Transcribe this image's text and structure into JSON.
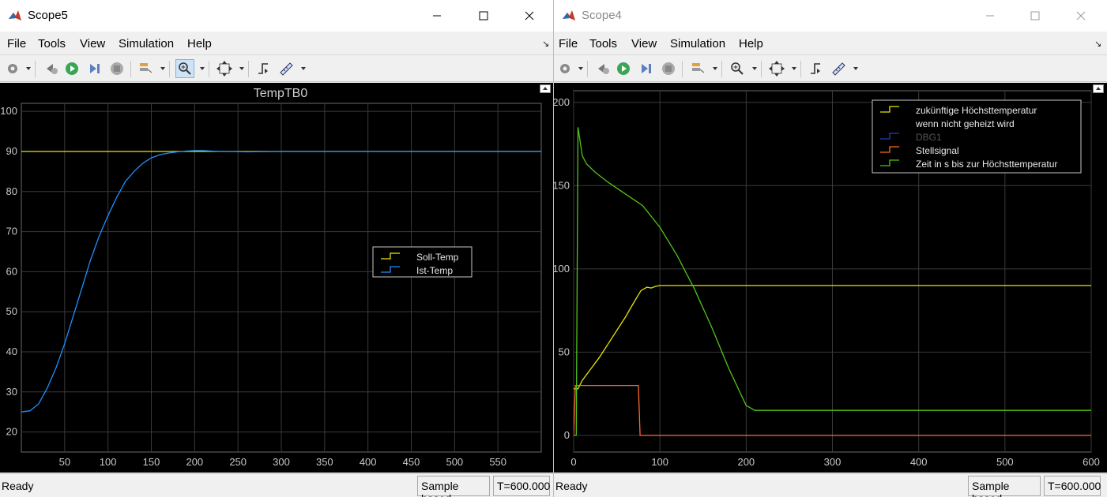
{
  "menu": [
    "File",
    "Tools",
    "View",
    "Simulation",
    "Help"
  ],
  "scope5": {
    "title": "Scope5",
    "status": "Ready",
    "sample_mode": "Sample based",
    "time": "T=600.000",
    "chart_data": {
      "type": "line",
      "title": "TempTB0",
      "xlim": [
        0,
        600
      ],
      "ylim": [
        15,
        102
      ],
      "xticks": [
        50,
        100,
        150,
        200,
        250,
        300,
        350,
        400,
        450,
        500,
        550
      ],
      "yticks": [
        20,
        30,
        40,
        50,
        60,
        70,
        80,
        90,
        100
      ],
      "grid": true,
      "legend_position": "center-right",
      "series": [
        {
          "name": "Soll-Temp",
          "color": "#e6e600",
          "x": [
            0,
            600
          ],
          "y": [
            90,
            90
          ]
        },
        {
          "name": "Ist-Temp",
          "color": "#1e90ff",
          "x": [
            0,
            10,
            20,
            30,
            40,
            50,
            60,
            70,
            80,
            90,
            100,
            110,
            120,
            130,
            140,
            150,
            160,
            170,
            180,
            190,
            200,
            210,
            220,
            230,
            240,
            260,
            300,
            400,
            500,
            600
          ],
          "y": [
            25,
            25.3,
            27,
            31,
            36,
            42,
            49,
            56,
            63,
            69,
            74,
            78.5,
            82.5,
            85,
            87,
            88.4,
            89.2,
            89.6,
            89.9,
            90.1,
            90.2,
            90.2,
            90.1,
            90,
            90,
            89.9,
            90,
            90,
            90,
            90
          ]
        }
      ]
    }
  },
  "scope4": {
    "title": "Scope4",
    "status": "Ready",
    "sample_mode": "Sample based",
    "time": "T=600.000",
    "chart_data": {
      "type": "line",
      "title": "",
      "xlim": [
        0,
        600
      ],
      "ylim": [
        -10,
        207
      ],
      "xticks": [
        0,
        100,
        200,
        300,
        400,
        500,
        600
      ],
      "yticks": [
        0,
        50,
        100,
        150,
        200
      ],
      "grid": true,
      "legend_position": "top-right",
      "series": [
        {
          "name": "zukünftige Höchsttemperatur wenn nicht geheizt wird",
          "color": "#e6e600",
          "x": [
            0,
            5,
            10,
            20,
            30,
            40,
            50,
            60,
            70,
            78,
            85,
            90,
            95,
            100,
            120,
            150,
            200,
            300,
            400,
            500,
            600
          ],
          "y": [
            28,
            28,
            33,
            40,
            47,
            55,
            63,
            71,
            80,
            87,
            89,
            88.5,
            89.5,
            90,
            90,
            90,
            90,
            90,
            90,
            90,
            90
          ]
        },
        {
          "name": "DBG1",
          "color": "#1f3fbf",
          "x": [],
          "y": []
        },
        {
          "name": "Stellsignal",
          "color": "#ff6a2a",
          "x": [
            0,
            2,
            75,
            77,
            600
          ],
          "y": [
            0,
            30,
            30,
            0,
            0
          ]
        },
        {
          "name": "Zeit in s bis zur Höchsttemperatur",
          "color": "#52c41a",
          "x": [
            0,
            3,
            5,
            8,
            10,
            15,
            25,
            40,
            60,
            80,
            100,
            120,
            140,
            160,
            180,
            200,
            210,
            300,
            400,
            500,
            600
          ],
          "y": [
            0,
            0,
            185,
            175,
            168,
            163,
            158,
            152,
            145,
            138,
            125,
            108,
            88,
            65,
            40,
            18,
            15,
            15,
            15,
            15,
            15
          ]
        }
      ]
    }
  }
}
